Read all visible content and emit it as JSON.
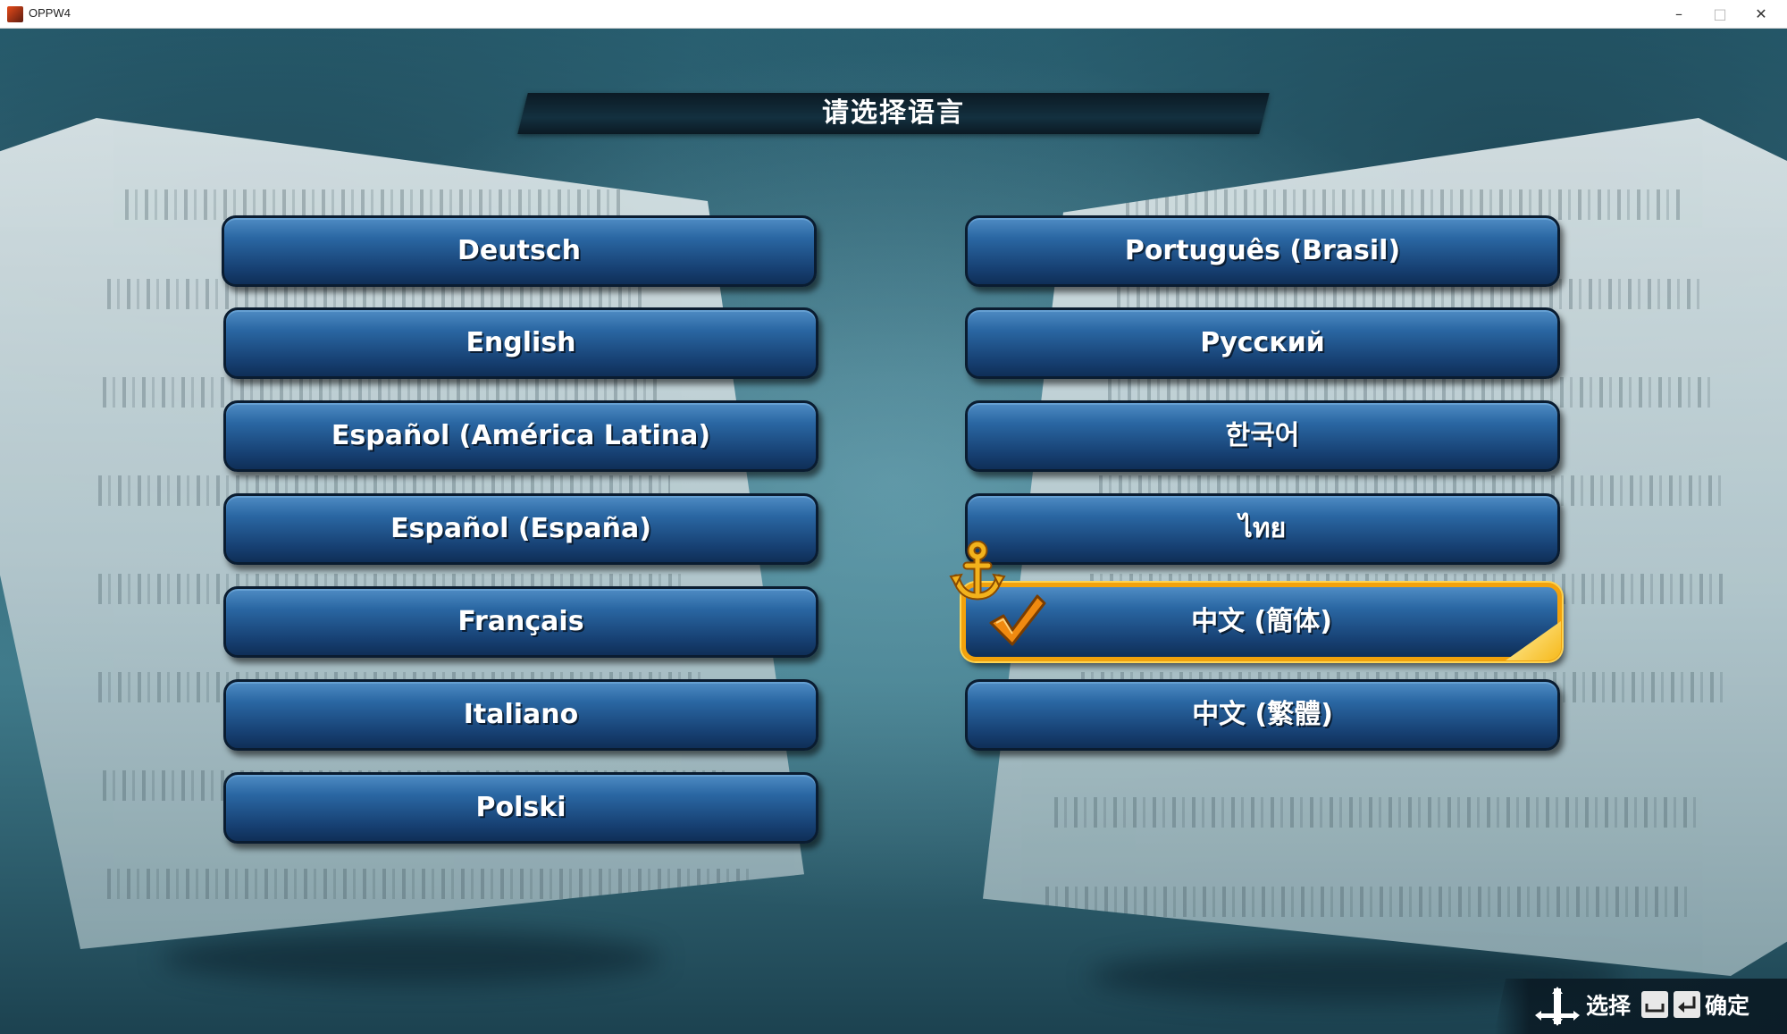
{
  "window": {
    "title": "OPPW4",
    "minimize_glyph": "–",
    "maximize_glyph": "□",
    "close_glyph": "✕"
  },
  "header": {
    "title": "请选择语言"
  },
  "languages": {
    "left": [
      {
        "label": "Deutsch"
      },
      {
        "label": "English"
      },
      {
        "label": "Español (América Latina)"
      },
      {
        "label": "Español (España)"
      },
      {
        "label": "Français"
      },
      {
        "label": "Italiano"
      },
      {
        "label": "Polski"
      }
    ],
    "right": [
      {
        "label": "Português (Brasil)"
      },
      {
        "label": "Русский"
      },
      {
        "label": "한국어"
      },
      {
        "label": "ไทย"
      },
      {
        "label": "中文 (簡体)",
        "selected": true
      },
      {
        "label": "中文 (繁體)"
      }
    ],
    "selected_label": "中文 (簡体)"
  },
  "footer": {
    "select_label": "选择",
    "confirm_label": "确定",
    "icons": [
      "dpad-icon",
      "space-key-icon",
      "enter-key-icon"
    ]
  },
  "colors": {
    "button_blue": "#2a67a3",
    "button_dark": "#0f2f57",
    "selected_border": "#f2a20c",
    "check_orange": "#f08a10",
    "anchor_gold": "#f2b21c"
  }
}
